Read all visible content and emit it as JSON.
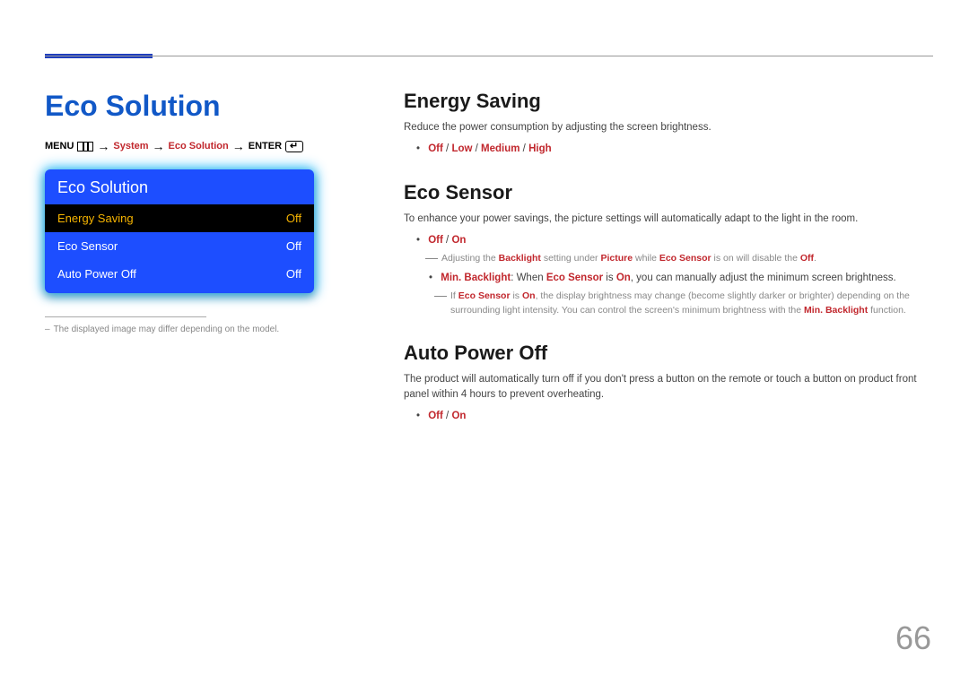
{
  "page_number": "66",
  "left": {
    "title": "Eco Solution",
    "breadcrumb": {
      "menu": "MENU",
      "system": "System",
      "eco": "Eco Solution",
      "enter": "ENTER"
    },
    "osd_title": "Eco Solution",
    "rows": [
      {
        "label": "Energy Saving",
        "value": "Off",
        "selected": true
      },
      {
        "label": "Eco Sensor",
        "value": "Off",
        "selected": false
      },
      {
        "label": "Auto Power Off",
        "value": "Off",
        "selected": false
      }
    ],
    "footnote": "The displayed image may differ depending on the model."
  },
  "right": {
    "energy": {
      "heading": "Energy Saving",
      "body": "Reduce the power consumption by adjusting the screen brightness.",
      "opts": [
        "Off",
        "Low",
        "Medium",
        "High"
      ]
    },
    "eco": {
      "heading": "Eco Sensor",
      "body": "To enhance your power savings, the picture settings will automatically adapt to the light in the room.",
      "opts": [
        "Off",
        "On"
      ],
      "note1_pre": "Adjusting the ",
      "note1_backlight": "Backlight",
      "note1_mid1": " setting under ",
      "note1_picture": "Picture",
      "note1_mid2": " while ",
      "note1_ecosensor": "Eco Sensor",
      "note1_mid3": " is on will disable the ",
      "note1_off": "Off",
      "note1_end": ".",
      "sub_minbk": "Min. Backlight",
      "sub_text1": ": When ",
      "sub_eco": "Eco Sensor",
      "sub_text2": " is ",
      "sub_on": "On",
      "sub_text3": ", you can manually adjust the minimum screen brightness.",
      "subnote_pre": "If ",
      "subnote_eco": "Eco Sensor",
      "subnote_mid1": " is ",
      "subnote_on": "On",
      "subnote_body": ", the display brightness may change (become slightly darker or brighter) depending on the surrounding light intensity. You can control the screen's minimum brightness with the ",
      "subnote_minbk": "Min. Backlight",
      "subnote_end": " function."
    },
    "auto": {
      "heading": "Auto Power Off",
      "body": "The product will automatically turn off if you don't press a button on the remote or touch a button on product front panel within 4 hours to prevent overheating.",
      "opts": [
        "Off",
        "On"
      ]
    }
  }
}
